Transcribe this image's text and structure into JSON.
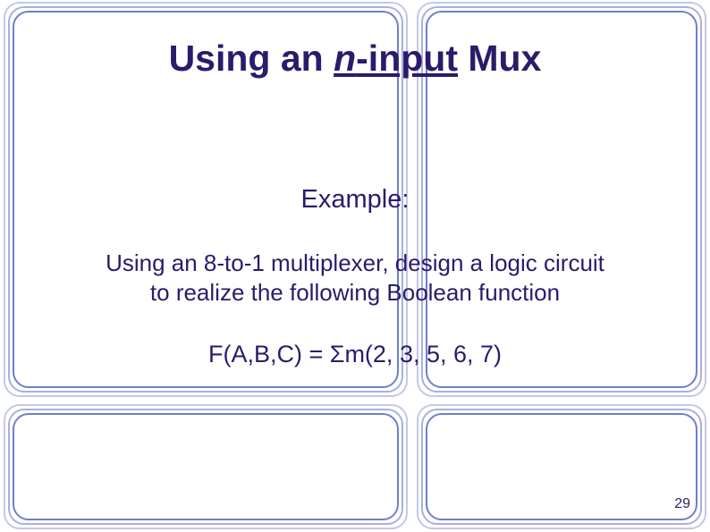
{
  "title": {
    "prefix": "Using an ",
    "n": "n",
    "input_suffix": "-input",
    "suffix": " Mux"
  },
  "example_label": "Example:",
  "body": {
    "line1": "Using an 8-to-1 multiplexer, design a logic circuit",
    "line2": "to realize the following Boolean function"
  },
  "formula": {
    "lhs": "F(A,B,C) = ",
    "sigma": "Σ",
    "rhs": "m(2, 3, 5, 6, 7)"
  },
  "page_number": "29"
}
